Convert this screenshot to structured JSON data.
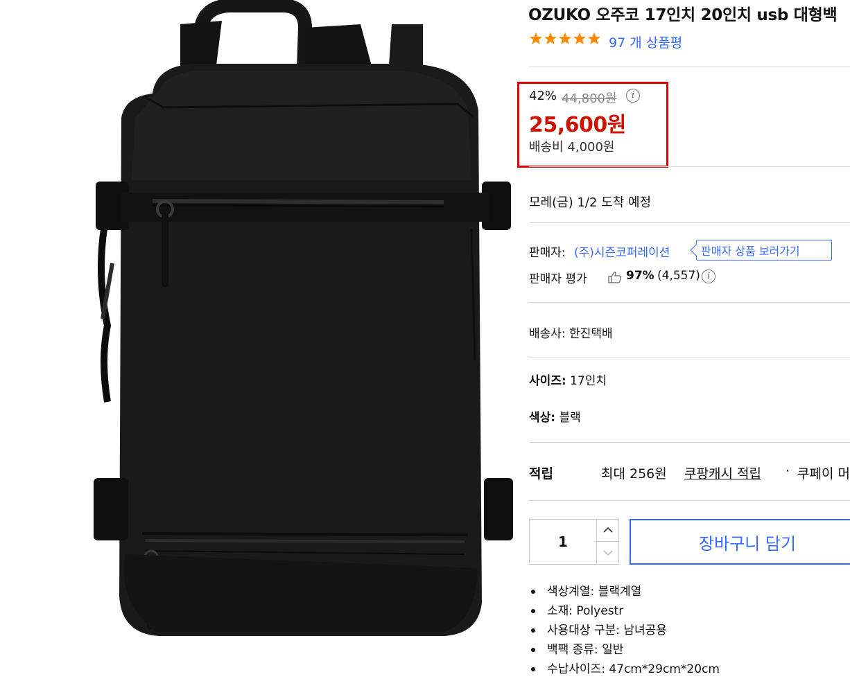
{
  "product": {
    "title": "OZUKO 오주코 17인치 20인치 usb 대형백",
    "rating_stars": 5,
    "review_text": "97 개 상품평"
  },
  "price": {
    "discount": "42%",
    "original": "44,800원",
    "sale": "25,600원",
    "shipping_fee": "배송비 4,000원",
    "highlight_color": "#e00000"
  },
  "delivery": {
    "arrival": "모레(금) 1/2 도착 예정"
  },
  "seller": {
    "label": "판매자:",
    "name": "(주)시즌코퍼레이션",
    "button": "판매자 상품 보러가기",
    "rating_label": "판매자 평가",
    "rating_percent": "97%",
    "rating_count": "(4,557)"
  },
  "courier": {
    "text": "배송사:  한진택배"
  },
  "options": {
    "size_label": "사이즈:",
    "size_value": " 17인치",
    "color_label": "색상:",
    "color_value": " 블랙"
  },
  "points": {
    "label": "적립",
    "max": "최대 256원",
    "link": "쿠팡캐시 적립",
    "sep": "·",
    "pay": "쿠페이 머"
  },
  "purchase": {
    "quantity": "1",
    "add_to_cart": "장바구니 담기",
    "accent": "#346aff"
  },
  "attributes": [
    "색상계열: 블랙계열",
    "소재: Polyestr",
    "사용대상 구분: 남녀공용",
    "백팩 종류: 일반",
    "수납사이즈: 47cm*29cm*20cm"
  ],
  "icons": [
    "star-icon",
    "info-icon",
    "thumbs-up-icon",
    "chevron-up-icon",
    "chevron-down-icon",
    "bullet-icon"
  ]
}
